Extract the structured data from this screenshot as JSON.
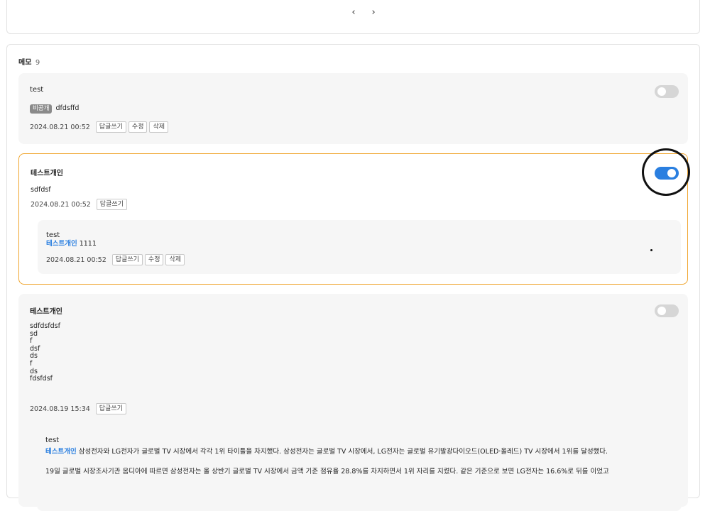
{
  "pager": {
    "prev": "‹",
    "next": "›"
  },
  "memo": {
    "title": "메모",
    "count": "9",
    "items": [
      {
        "author": "test",
        "badge": "비공개",
        "content": "dfdsffd",
        "date": "2024.08.21 00:52",
        "buttons": [
          "답글쓰기",
          "수정",
          "삭제"
        ],
        "toggle": "off"
      },
      {
        "author": "테스트개인",
        "content": "sdfdsf",
        "date": "2024.08.21 00:52",
        "buttons": [
          "답글쓰기"
        ],
        "toggle": "on",
        "reply": {
          "author": "test",
          "mention": "테스트개인",
          "content": "1111",
          "date": "2024.08.21 00:52",
          "buttons": [
            "답글쓰기",
            "수정",
            "삭제"
          ]
        }
      },
      {
        "author": "테스트개인",
        "content": "sdfdsfdsf\nsd\nf\ndsf\nds\nf\nds\nfdsfdsf",
        "date": "2024.08.19 15:34",
        "buttons": [
          "답글쓰기"
        ],
        "toggle": "off",
        "reply": {
          "author": "test",
          "mention": "테스트개인",
          "content": "삼성전자와 LG전자가 글로벌 TV 시장에서 각각 1위 타이틀을 차지했다. 삼성전자는 글로벌 TV 시장에서, LG전자는 글로벌 유기발광다이오드(OLED·올레드) TV 시장에서 1위를 달성했다.",
          "paragraph2": "19일 글로벌 시장조사기관 옴디아에 따르면 삼성전자는 올 상반기 글로벌 TV 시장에서 금액 기준 점유율 28.8%를 차지하면서 1위 자리를 지켰다. 같은 기준으로 보면 LG전자는 16.6%로 뒤를 이었고"
        }
      }
    ]
  },
  "colors": {
    "accent": "#2a7fe0",
    "active_border": "#f0a52e",
    "card_bg": "#f6f6f6"
  }
}
